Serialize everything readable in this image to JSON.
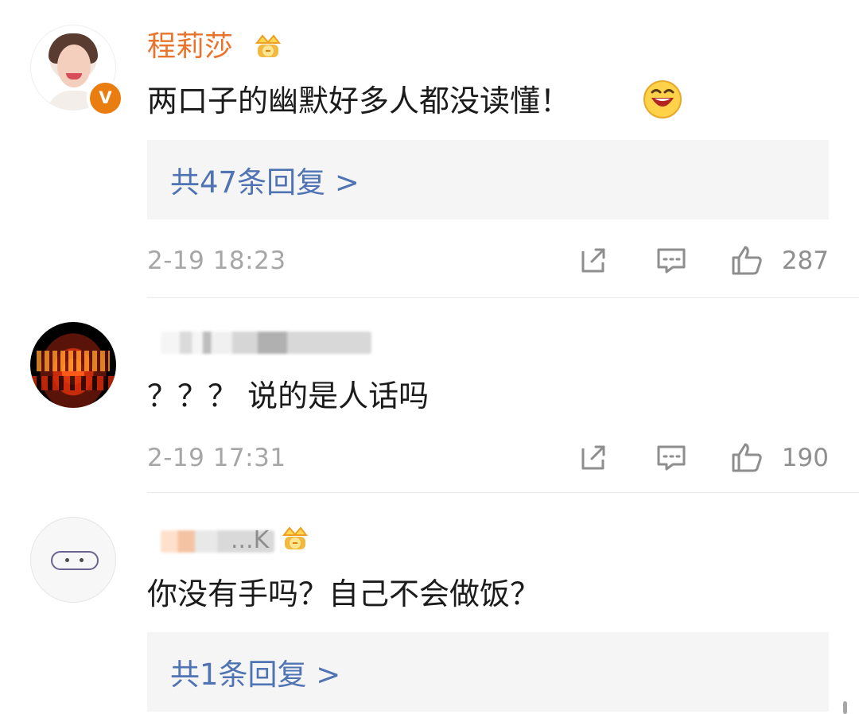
{
  "comments": [
    {
      "author": "程莉莎",
      "verified_label": "V",
      "text": "两口子的幽默好多人都没读懂！",
      "emoji": "grin-emoji",
      "replies_label": "共47条回复 >",
      "time": "2-19 18:23",
      "likes": "287"
    },
    {
      "author": "",
      "text": "？？？ 说的是人话吗",
      "time": "2-19 17:31",
      "likes": "190"
    },
    {
      "author": "",
      "visible_name_fragment": "...K",
      "text": "你没有手吗？自己不会做饭？",
      "replies_label": "共1条回复 >"
    }
  ],
  "icons": {
    "crown": "crown-icon",
    "share": "share-icon",
    "comment": "comment-icon",
    "like": "like-icon"
  },
  "colors": {
    "author": "#e8742d",
    "replies_link": "#4f73b3",
    "meta": "#a6a6a6",
    "verified_badge": "#ea7d0f",
    "divider": "#e9e9e9"
  }
}
